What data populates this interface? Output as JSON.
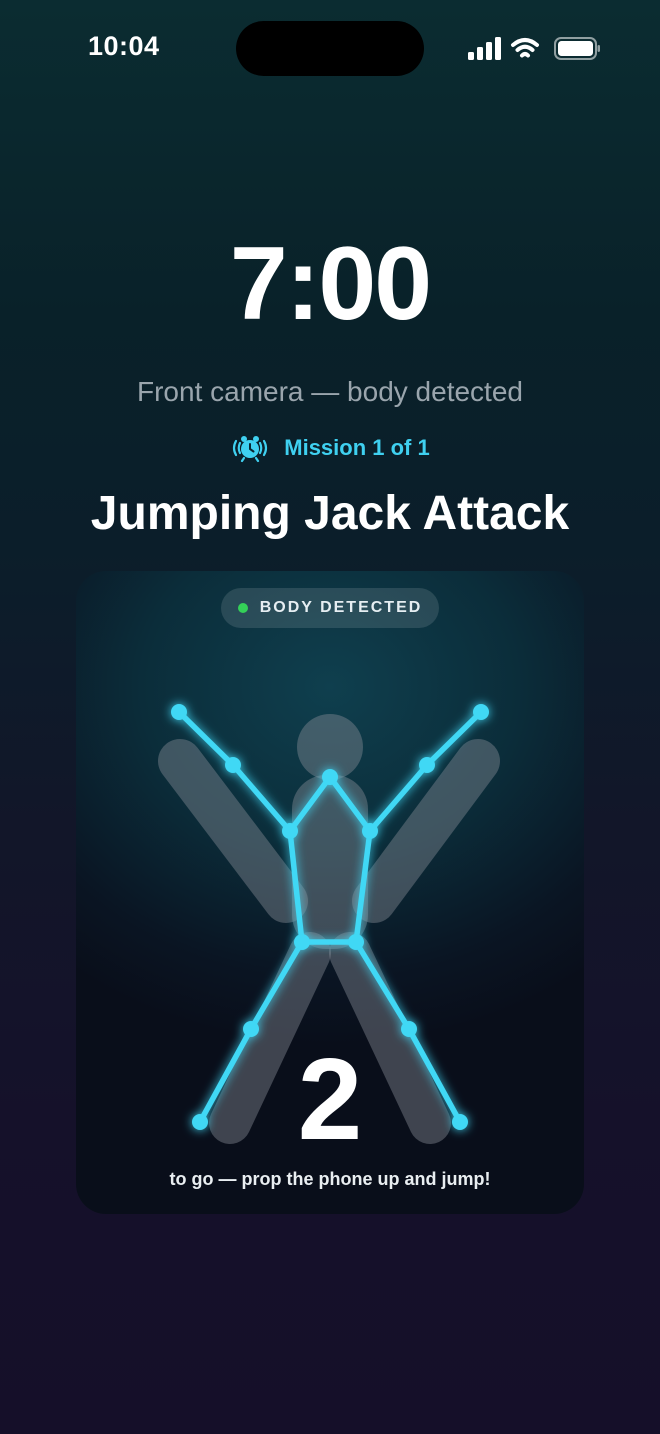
{
  "status_bar": {
    "time": "10:04",
    "icons": [
      "cellular-signal-icon",
      "wifi-icon",
      "battery-icon"
    ]
  },
  "alarm": {
    "time": "7:00",
    "camera_status": "Front camera — body detected",
    "mission_label": "Mission 1 of 1",
    "mission_icon": "ringing-alarm-clock-icon",
    "mission_title": "Jumping Jack Attack"
  },
  "camera_card": {
    "badge_text": "BODY DETECTED",
    "badge_status_color": "#34d058",
    "reps_remaining": "2",
    "hint": "to go — prop the phone up and jump!"
  },
  "colors": {
    "accent": "#3fd0f0",
    "skeleton": "#3fd8f5"
  }
}
